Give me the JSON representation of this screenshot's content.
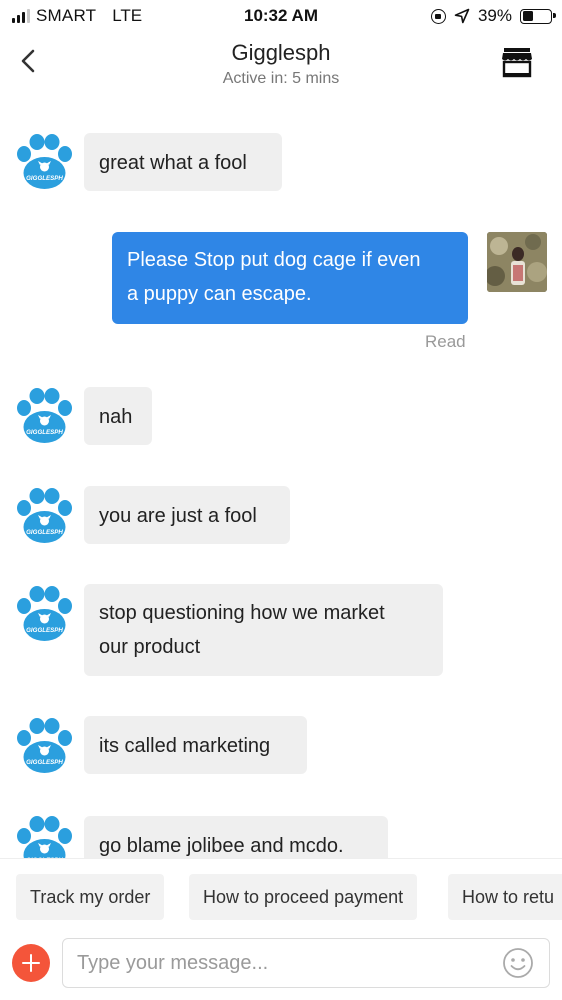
{
  "status_bar": {
    "carrier": "SMART",
    "network": "LTE",
    "time": "10:32 AM",
    "battery_text": "39%",
    "battery_level": 0.39
  },
  "header": {
    "title": "Gigglesph",
    "subtitle": "Active in: 5 mins"
  },
  "shop_logo_text": "GIGGLESPH",
  "colors": {
    "outgoing_bubble": "#2f86e6",
    "incoming_bubble": "#efefef",
    "paw_logo": "#2b9fde",
    "plus_button": "#f4553a"
  },
  "messages": [
    {
      "sender": "shop",
      "text": "great what a fool"
    },
    {
      "sender": "me",
      "text_line1": "Please Stop put dog cage if even",
      "text_line2": "a puppy can escape.",
      "status": "Read"
    },
    {
      "sender": "shop",
      "text": "nah"
    },
    {
      "sender": "shop",
      "text": "you are just a fool"
    },
    {
      "sender": "shop",
      "text_line1": "stop questioning how we market",
      "text_line2": "our product"
    },
    {
      "sender": "shop",
      "text": "its called marketing"
    },
    {
      "sender": "shop",
      "text": "go blame jolibee and mcdo."
    }
  ],
  "quick_replies": [
    {
      "label": "Track my order"
    },
    {
      "label": "How to proceed payment"
    },
    {
      "label": "How to retu"
    }
  ],
  "composer": {
    "placeholder": "Type your message..."
  },
  "icons": {
    "back": "chevron-left-icon",
    "shop": "store-icon",
    "add": "plus-icon",
    "emoji": "smiley-icon"
  }
}
